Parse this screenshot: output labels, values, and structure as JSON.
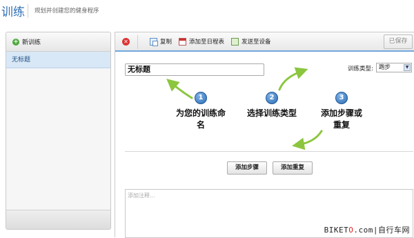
{
  "header": {
    "title": "训练",
    "subtitle": "规划并创建您的健身程序"
  },
  "sidebar": {
    "new_label": "新训练",
    "items": [
      {
        "label": "无标题",
        "selected": true
      }
    ]
  },
  "toolbar": {
    "copy_label": "复制",
    "schedule_label": "添加至日程表",
    "send_label": "发送至设备",
    "save_label": "已保存"
  },
  "workout": {
    "name": "无标题",
    "type_label": "训练类型:",
    "type_value": "跑步"
  },
  "steps": [
    {
      "number": "1",
      "text_line1": "为您的训练命",
      "text_line2": "名"
    },
    {
      "number": "2",
      "text_line1": "选择训练类型",
      "text_line2": ""
    },
    {
      "number": "3",
      "text_line1": "添加步骤或",
      "text_line2": "重复"
    }
  ],
  "actions": {
    "add_step_label": "添加步骤",
    "add_repeat_label": "添加重复"
  },
  "notes": {
    "placeholder": "添加注释..."
  },
  "watermark": {
    "part1": "BIKET",
    "part2": "O",
    "part3": ".com",
    "part4": "|自行车网"
  },
  "colors": {
    "accent": "#2f6fb5",
    "arrow": "#8cc63f",
    "selected_bg": "#d8e8f6"
  }
}
